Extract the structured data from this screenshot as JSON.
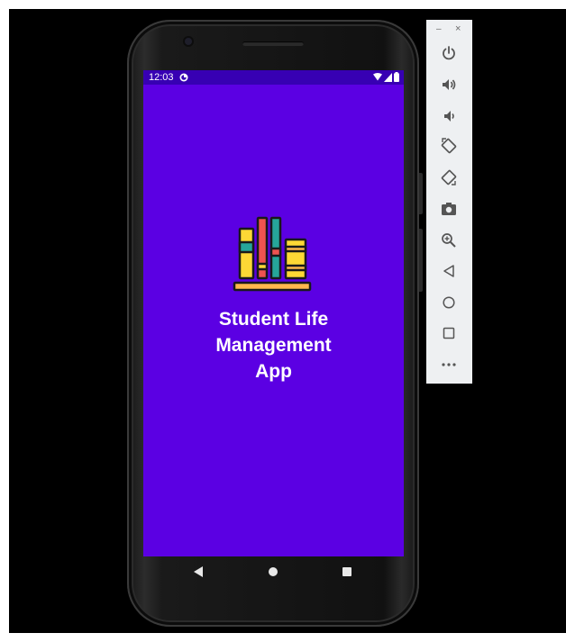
{
  "status_bar": {
    "time": "12:03"
  },
  "app": {
    "title_lines": [
      "Student Life",
      "Management",
      "App"
    ],
    "background_color": "#5b00e3",
    "status_bar_color": "#3700b3",
    "logo_icon": "books-on-shelf-icon"
  },
  "navigation_bar": {
    "buttons": [
      "back-icon",
      "home-icon",
      "recents-icon"
    ]
  },
  "emulator_toolbar": {
    "minimize_label": "–",
    "close_label": "×",
    "buttons": [
      "power-icon",
      "volume-up-icon",
      "volume-down-icon",
      "rotate-left-icon",
      "rotate-right-icon",
      "screenshot-icon",
      "zoom-icon",
      "back-icon",
      "home-icon",
      "overview-icon",
      "more-icon"
    ]
  }
}
